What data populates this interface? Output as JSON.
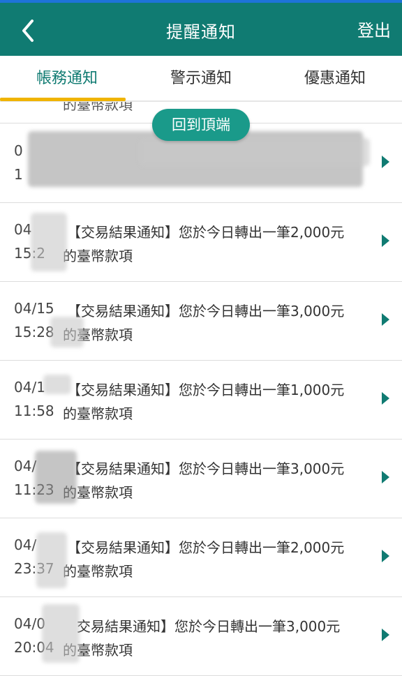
{
  "header": {
    "title": "提醒通知",
    "logout_label": "登出"
  },
  "tabs": [
    {
      "label": "帳務通知"
    },
    {
      "label": "警示通知"
    },
    {
      "label": "優惠通知"
    }
  ],
  "partial_row": {
    "text": "的臺幣款項"
  },
  "back_to_top_label": "回到頂端",
  "notifications": [
    {
      "date": "0",
      "time": "1",
      "line1": "",
      "line2": ""
    },
    {
      "date": "04",
      "time": "15:2",
      "line1": "【交易結果通知】您於今日轉出一筆2,000元",
      "line2": "的臺幣款項"
    },
    {
      "date": "04/15",
      "time": "15:28",
      "line1": "【交易結果通知】您於今日轉出一筆3,000元",
      "line2": "的臺幣款項"
    },
    {
      "date": "04/1",
      "time": "11:58",
      "line1": "【交易結果通知】您於今日轉出一筆1,000元",
      "line2": "的臺幣款項"
    },
    {
      "date": "04/",
      "time": "11:23",
      "line1": "【交易結果通知】您於今日轉出一筆3,000元",
      "line2": "的臺幣款項"
    },
    {
      "date": "04/",
      "time": "23:37",
      "line1": "【交易結果通知】您於今日轉出一筆2,000元",
      "line2": "的臺幣款項"
    },
    {
      "date": "04/0",
      "time": "20:04",
      "line1": "交易結果通知】您於今日轉出一筆3,000元",
      "line2": "的臺幣款項"
    }
  ],
  "colors": {
    "header_bg": "#107b72",
    "accent_indicator": "#f0b400",
    "back_to_top_bg": "#1a9a8a"
  },
  "icons": {
    "back": "chevron-left-icon",
    "row_arrow": "triangle-right-icon"
  }
}
